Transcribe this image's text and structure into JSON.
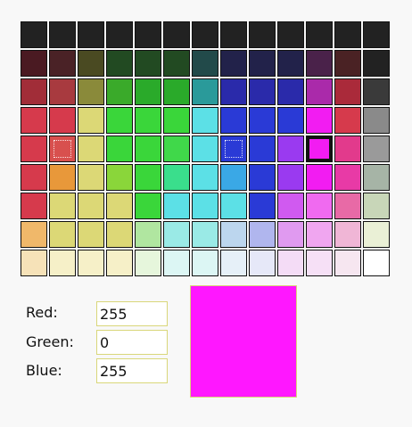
{
  "palette": {
    "columns": 13,
    "selected": [
      4,
      10
    ],
    "hatched": [
      [
        4,
        1
      ],
      [
        4,
        7
      ]
    ],
    "rows": [
      [
        "#222222",
        "#222222",
        "#222222",
        "#222222",
        "#222222",
        "#222222",
        "#222222",
        "#222222",
        "#222222",
        "#222222",
        "#222222",
        "#222222",
        "#222222"
      ],
      [
        "#4a1a22",
        "#4a2226",
        "#4a4a22",
        "#224a22",
        "#224a22",
        "#224a22",
        "#224a4a",
        "#22224a",
        "#22224a",
        "#22224a",
        "#4a224a",
        "#4a2224",
        "#222222"
      ],
      [
        "#a12d38",
        "#a83a3f",
        "#8a8a3a",
        "#3aaa2a",
        "#2aaa2a",
        "#2aaa2a",
        "#2a9a9a",
        "#2a2aaa",
        "#2a2aaa",
        "#2a2aaa",
        "#aa2aaa",
        "#aa2a3a",
        "#3a3a3a"
      ],
      [
        "#d63a4c",
        "#d63a4c",
        "#dcd876",
        "#3ad63a",
        "#3ad63a",
        "#3ad63a",
        "#5ce0e6",
        "#2a3ad6",
        "#2a3ad6",
        "#2a3ad6",
        "#f21cf2",
        "#d63a4c",
        "#8a8a8a"
      ],
      [
        "#d63a4c",
        "#d8504e",
        "#dcd876",
        "#3ad63a",
        "#3ad63a",
        "#40d84a",
        "#5ce0e6",
        "#2a3ad6",
        "#2a3ad6",
        "#9a3af0",
        "#f21cf2",
        "#e23a8c",
        "#9a9a9a"
      ],
      [
        "#d63a4c",
        "#e8983a",
        "#dcd876",
        "#8ad63a",
        "#3ad63a",
        "#3ade8c",
        "#5ce0e6",
        "#3aa8e6",
        "#2a3ad6",
        "#9a3af0",
        "#f21cf2",
        "#e83aa6",
        "#a6b4a6"
      ],
      [
        "#d63a4c",
        "#dcd876",
        "#dcd876",
        "#dcd876",
        "#3ad63a",
        "#5ce0e6",
        "#5ce0e6",
        "#5ce0e6",
        "#2a3ad6",
        "#d05af0",
        "#f06af0",
        "#e86aa6",
        "#c8d6b8"
      ],
      [
        "#f0b86a",
        "#dcd876",
        "#dcd876",
        "#dcd876",
        "#b0e6a0",
        "#9aeae6",
        "#9aeae6",
        "#bcd6ee",
        "#b0b6ee",
        "#e09af0",
        "#f0a6f0",
        "#f0b6d6",
        "#eaf0d6"
      ],
      [
        "#f6e2b8",
        "#f6f0c8",
        "#f6f0c8",
        "#f6f0c8",
        "#e6f6dc",
        "#dcf6f4",
        "#dcf6f4",
        "#e6f0f8",
        "#e6e8f8",
        "#f4dcf6",
        "#f6e0f6",
        "#f6e6f0",
        "#ffffff"
      ]
    ]
  },
  "form": {
    "red_label": "Red:",
    "green_label": "Green:",
    "blue_label": "Blue:",
    "red_value": "255",
    "green_value": "0",
    "blue_value": "255"
  },
  "preview": {
    "color": "#ff17ff"
  }
}
